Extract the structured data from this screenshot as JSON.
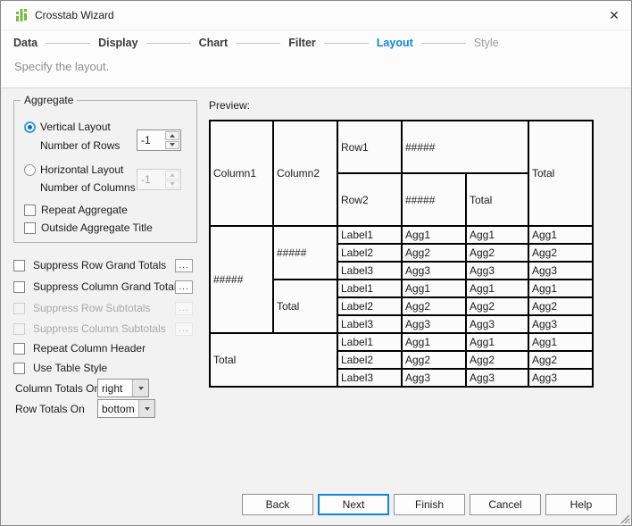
{
  "window": {
    "title": "Crosstab Wizard"
  },
  "icons": {
    "close": "✕",
    "app": "crosstab-chart-icon",
    "dropdown_arrow": "triangle-down",
    "spinner_arrows": "triangle-up-down"
  },
  "colors": {
    "accent_blue": "#1188d5",
    "icon_green": "#76bc43",
    "active_step": "#1188d5",
    "disabled_text": "#a8a8a8",
    "table_border": "#000000"
  },
  "steps": {
    "items": [
      {
        "label": "Data"
      },
      {
        "label": "Display"
      },
      {
        "label": "Chart"
      },
      {
        "label": "Filter"
      },
      {
        "label": "Layout"
      },
      {
        "label": "Style"
      }
    ],
    "active": "Layout"
  },
  "subtitle": "Specify the layout.",
  "aggregate": {
    "title": "Aggregate",
    "vertical_label": "Vertical Layout",
    "vertical_sub": "Number of Rows",
    "vertical_value": "-1",
    "vertical_selected": true,
    "horizontal_label": "Horizontal Layout",
    "horizontal_sub": "Number of Columns",
    "horizontal_value": "-1",
    "horizontal_selected": false,
    "repeat_label": "Repeat Aggregate",
    "outside_label": "Outside Aggregate Title"
  },
  "options": {
    "suppress_row_grand": "Suppress Row Grand Totals",
    "suppress_col_grand": "Suppress Column Grand Totals",
    "suppress_row_sub": "Suppress Row Subtotals",
    "suppress_col_sub": "Suppress Column Subtotals",
    "repeat_col_header": "Repeat Column Header",
    "use_table_style": "Use Table Style",
    "ellipsis": "...",
    "column_totals_label": "Column Totals On",
    "column_totals_value": "right",
    "row_totals_label": "Row Totals On",
    "row_totals_value": "bottom"
  },
  "preview": {
    "label": "Preview:",
    "column1": "Column1",
    "column2": "Column2",
    "row1": "Row1",
    "row2": "Row2",
    "hash": "#####",
    "total": "Total",
    "labels": [
      "Label1",
      "Label2",
      "Label3"
    ],
    "aggs": [
      "Agg1",
      "Agg2",
      "Agg3"
    ]
  },
  "footer": {
    "back": "Back",
    "next": "Next",
    "finish": "Finish",
    "cancel": "Cancel",
    "help": "Help"
  }
}
